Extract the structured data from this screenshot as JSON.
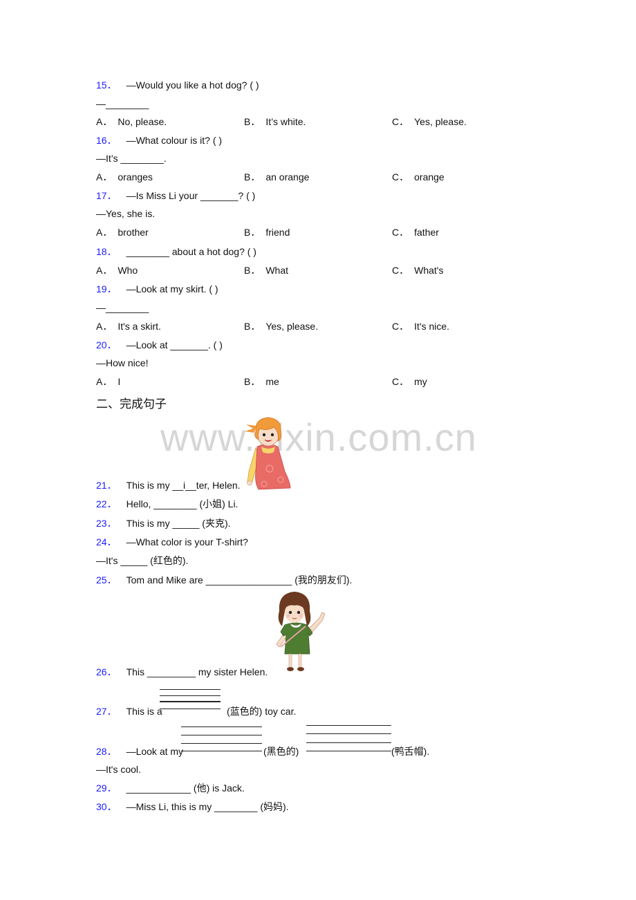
{
  "watermark": "www.zixin.com.cn",
  "section_heading": "二、完成句子",
  "mc_questions": [
    {
      "num": "15．",
      "stem": "—Would you like a hot dog? (     )",
      "reply": "—________",
      "options": [
        {
          "label": "A．",
          "text": "No, please."
        },
        {
          "label": "B．",
          "text": "It’s white."
        },
        {
          "label": "C．",
          "text": "Yes, please."
        }
      ]
    },
    {
      "num": "16．",
      "stem": "—What colour is it? (    )",
      "reply": "—It’s ________.",
      "options": [
        {
          "label": "A．",
          "text": "oranges"
        },
        {
          "label": "B．",
          "text": "an orange"
        },
        {
          "label": "C．",
          "text": "orange"
        }
      ]
    },
    {
      "num": "17．",
      "stem": "—Is Miss Li your _______? (   )",
      "reply": "—Yes, she is.",
      "options": [
        {
          "label": "A．",
          "text": "brother"
        },
        {
          "label": "B．",
          "text": "friend"
        },
        {
          "label": "C．",
          "text": "father"
        }
      ]
    },
    {
      "num": "18．",
      "stem": "________ about a hot dog? (  )",
      "reply": "",
      "options": [
        {
          "label": "A．",
          "text": "Who"
        },
        {
          "label": "B．",
          "text": "What"
        },
        {
          "label": "C．",
          "text": "What's"
        }
      ]
    },
    {
      "num": "19．",
      "stem": "—Look at my skirt. (  )",
      "reply": "—________",
      "options": [
        {
          "label": "A．",
          "text": "It's a skirt."
        },
        {
          "label": "B．",
          "text": "Yes, please."
        },
        {
          "label": "C．",
          "text": "It's nice."
        }
      ]
    },
    {
      "num": "20．",
      "stem": "—Look at _______. (   )",
      "reply": "—How nice!",
      "options": [
        {
          "label": "A．",
          "text": "I"
        },
        {
          "label": "B．",
          "text": "me"
        },
        {
          "label": "C．",
          "text": "my"
        }
      ]
    }
  ],
  "fill_questions": [
    {
      "num": "21．",
      "text": "This is my __i__ter, Helen."
    },
    {
      "num": "22．",
      "text": "Hello, ________ (小姐) Li."
    },
    {
      "num": "23．",
      "text": "This is my _____ (夹克)."
    },
    {
      "num": "24．",
      "text": "—What color is your T-shirt?",
      "reply": "—It's _____ (红色的)."
    },
    {
      "num": "25．",
      "text": "Tom and Mike are ________________ (我的朋友们)."
    },
    {
      "num": "26．",
      "text": "This _________ my sister Helen."
    },
    {
      "num": "27．",
      "pre": "This is a",
      "post": "(蓝色的) toy car."
    },
    {
      "num": "28．",
      "pre": "—Look at my",
      "mid": "(黑色的)",
      "post": "(鸭舌帽).",
      "reply": "—It's cool."
    },
    {
      "num": "29．",
      "text": "____________ (他) is Jack."
    },
    {
      "num": "30．",
      "text": "—Miss Li, this is my ________ (妈妈)."
    }
  ],
  "colors": {
    "question_number": "#1a1aff",
    "text": "#111111",
    "watermark": "#d6d6d6"
  }
}
